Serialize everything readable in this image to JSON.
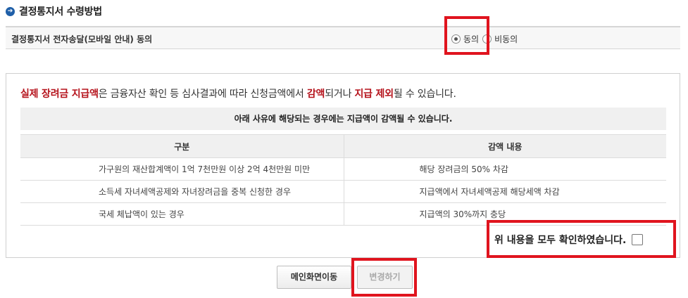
{
  "section": {
    "title": "결정통지서 수령방법",
    "icon": "arrow-right-circle-icon"
  },
  "consent": {
    "label": "결정통지서 전자송달(모바일 안내) 동의",
    "options": [
      {
        "label": "동의",
        "checked": true
      },
      {
        "label": "비동의",
        "checked": false
      }
    ]
  },
  "notice": {
    "headline_parts": [
      {
        "text": "실제 장려금 지급액",
        "highlight": true
      },
      {
        "text": "은 금융자산 확인 등 심사결과에 따라 신청금액에서 ",
        "highlight": false
      },
      {
        "text": "감액",
        "highlight": true
      },
      {
        "text": "되거나 ",
        "highlight": false
      },
      {
        "text": "지급 제외",
        "highlight": true
      },
      {
        "text": "될 수 있습니다.",
        "highlight": false
      }
    ],
    "reason_title": "아래 사유에 해당되는 경우에는 지급액이 감액될 수 있습니다.",
    "table": {
      "headers": [
        "구분",
        "감액 내용"
      ],
      "rows": [
        [
          "가구원의 재산합계액이 1억 7천만원 이상 2억 4천만원 미만",
          "해당 장려금의 50% 차감"
        ],
        [
          "소득세 자녀세액공제와 자녀장려금을 중복 신청한 경우",
          "지급액에서 자녀세액공제 해당세액 차감"
        ],
        [
          "국세 체납액이 있는 경우",
          "지급액의 30%까지 충당"
        ]
      ]
    },
    "confirm_label": "위 내용을 모두 확인하였습니다."
  },
  "buttons": {
    "main_label": "메인화면이동",
    "change_label": "변경하기"
  },
  "colors": {
    "highlight": "#b5121b",
    "annotation_box": "#e0141e",
    "title_icon": "#1f5fa8"
  }
}
